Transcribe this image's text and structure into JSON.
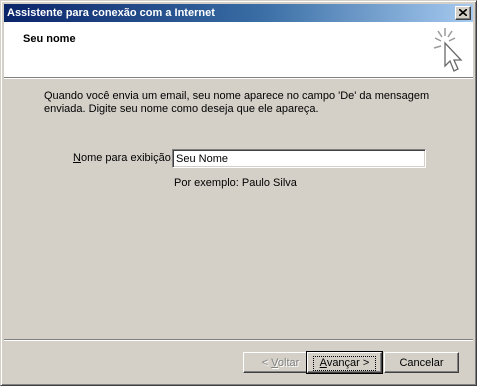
{
  "window": {
    "title": "Assistente para conexão com a Internet"
  },
  "header": {
    "title": "Seu nome",
    "icon": "wizard-sparkle-cursor-icon"
  },
  "content": {
    "description": "Quando você envia um email, seu nome aparece no campo 'De' da mensagem enviada. Digite seu nome como deseja que ele apareça.",
    "display_name_label": "Nome para exibição:",
    "display_name_value": "Seu Nome",
    "example": "Por exemplo: Paulo Silva"
  },
  "buttons": {
    "back": "< Voltar",
    "next": "Avançar >",
    "cancel": "Cancelar"
  },
  "colors": {
    "title_bar_start": "#0a246a",
    "title_bar_end": "#a6caf0",
    "face": "#d4d0c8"
  }
}
